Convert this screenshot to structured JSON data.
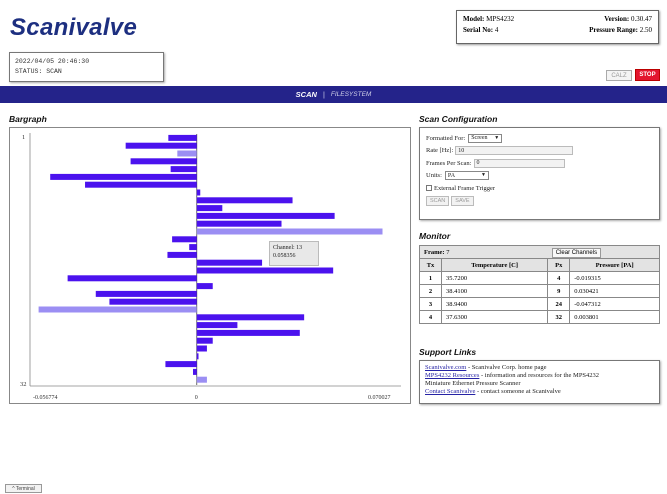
{
  "header": {
    "logo": "Scanivalve",
    "model_label": "Model:",
    "model_value": "MPS4232",
    "version_label": "Version:",
    "version_value": "0.30.47",
    "serial_label": "Serial No:",
    "serial_value": "4",
    "range_label": "Pressure Range:",
    "range_value": "2.50"
  },
  "status": {
    "datetime": "2022/04/05 20:46:30",
    "status_line": "STATUS: SCAN"
  },
  "controls": {
    "calz": "CALZ",
    "stop": "STOP"
  },
  "nav": {
    "scan": "SCAN",
    "separator": "|",
    "filesystem": "FILESYSTEM"
  },
  "bargraph": {
    "title": "Bargraph",
    "first_channel": "1",
    "last_channel": "32",
    "xmin_label": "-0.056774",
    "xzero_label": "0",
    "xmax_label": "0.070027",
    "tooltip_line1": "Channel: 13",
    "tooltip_line2": "0.058356"
  },
  "chart_data": {
    "type": "bar",
    "orientation": "horizontal",
    "xlim": [
      -0.056774,
      0.070027
    ],
    "colors": {
      "normal": "#4b12ee",
      "highlight": "#9b8ef3"
    },
    "categories": [
      "1",
      "2",
      "3",
      "4",
      "5",
      "6",
      "7",
      "8",
      "9",
      "10",
      "11",
      "12",
      "13",
      "14",
      "15",
      "16",
      "17",
      "18",
      "19",
      "20",
      "21",
      "22",
      "23",
      "24",
      "25",
      "26",
      "27",
      "28",
      "29",
      "30",
      "31",
      "32"
    ],
    "values": [
      -0.0098,
      -0.0245,
      -0.0067,
      -0.0228,
      -0.009,
      -0.0505,
      -0.0385,
      0.0012,
      0.033,
      0.0088,
      0.0475,
      0.0292,
      0.064,
      -0.0085,
      -0.0026,
      -0.0101,
      0.0225,
      0.047,
      -0.0445,
      0.0055,
      -0.0348,
      -0.0301,
      -0.0545,
      0.037,
      0.014,
      0.0355,
      0.0055,
      0.0035,
      0.0006,
      -0.0108,
      -0.0013,
      0.0035
    ],
    "highlighted": [
      3,
      13,
      23,
      32
    ]
  },
  "scan_config": {
    "title": "Scan Configuration",
    "formatted_for_label": "Formatted For:",
    "formatted_for_value": "Screen",
    "rate_label": "Rate [Hz]:",
    "rate_value": "10",
    "frames_label": "Frames Per Scan:",
    "frames_value": "0",
    "units_label": "Units:",
    "units_value": "PA",
    "trigger_label": "External Frame Trigger",
    "scan_button": "SCAN",
    "save_button": "SAVE"
  },
  "monitor": {
    "title": "Monitor",
    "frame_label": "Frame:",
    "frame_value": "7",
    "clear_button": "Clear Channels",
    "headers": [
      "Tx",
      "Temperature [C]",
      "Px",
      "Pressure [PA]"
    ],
    "rows": [
      [
        "1",
        "35.7200",
        "4",
        "-0.019315"
      ],
      [
        "2",
        "38.4100",
        "9",
        "0.030421"
      ],
      [
        "3",
        "38.9400",
        "24",
        "-0.047312"
      ],
      [
        "4",
        "37.6300",
        "32",
        "0.003801"
      ]
    ]
  },
  "support": {
    "title": "Support Links",
    "link1": "Scanivalve.com",
    "text1": " - Scanivalve Corp. home page",
    "link2": "MPS4232 Resources",
    "text2": " - information and resources for the MPS4232",
    "text2b": "Miniature Ethernet Pressure Scanner",
    "link3": "Contact Scanivalve",
    "text3": " - contact someone at Scanivalve"
  },
  "terminal": {
    "label": "^ Terminal"
  }
}
